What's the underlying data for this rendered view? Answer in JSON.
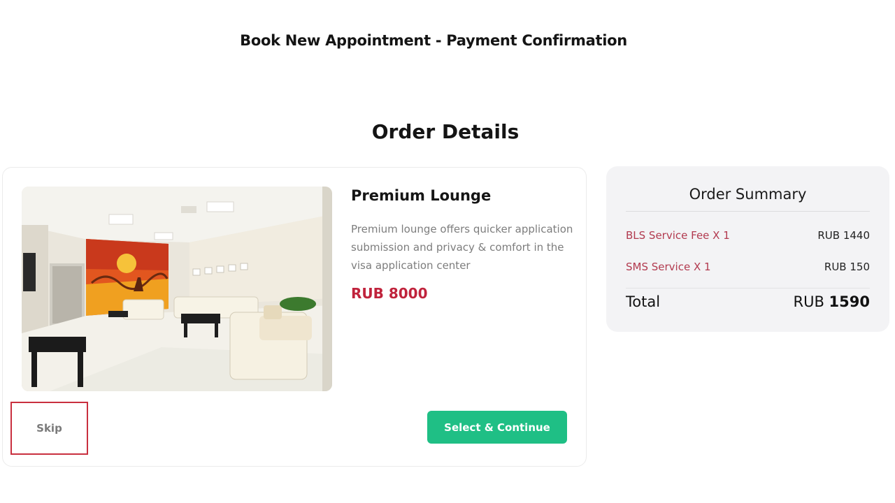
{
  "header": {
    "title": "Book New Appointment - Payment Confirmation"
  },
  "order": {
    "section_title": "Order Details",
    "product": {
      "name": "Premium Lounge",
      "description": "Premium lounge offers quicker application submission and privacy & comfort in the visa application center",
      "price": "RUB 8000"
    },
    "skip_label": "Skip",
    "continue_label": "Select & Continue"
  },
  "summary": {
    "title": "Order Summary",
    "items": [
      {
        "label": "BLS Service Fee X 1",
        "amount": "RUB 1440"
      },
      {
        "label": "SMS Service X 1",
        "amount": "RUB 150"
      }
    ],
    "total_label": "Total",
    "total_currency": "RUB",
    "total_value": "1590"
  },
  "colors": {
    "accent_green": "#1fbf85",
    "price_red": "#c0233c",
    "item_label_red": "#b23a4f",
    "skip_border": "#c9303f",
    "summary_bg": "#f3f3f5"
  }
}
